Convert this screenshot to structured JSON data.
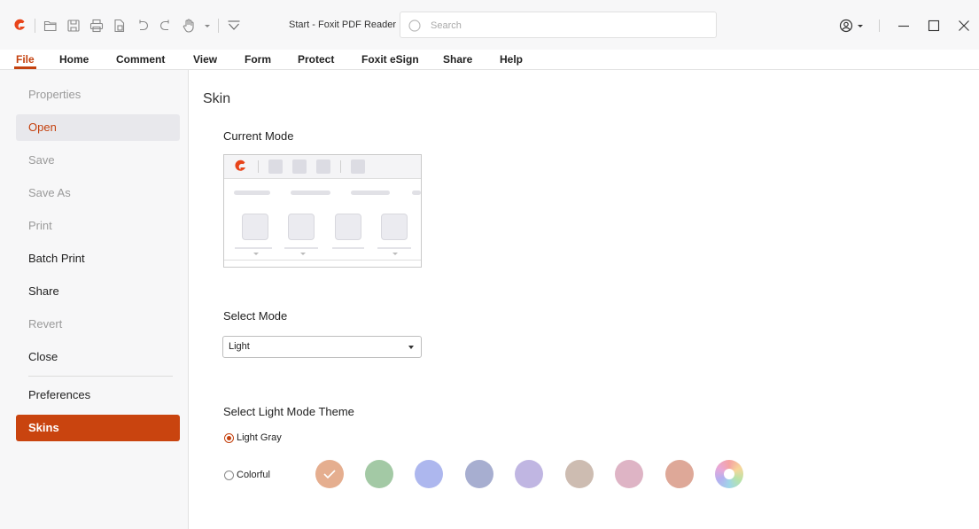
{
  "titlebar": {
    "doc_title": "Start - Foxit PDF Reader",
    "search_placeholder": "Search",
    "accent_color": "#e8441a",
    "icons": [
      "foxit-logo-icon",
      "open-icon",
      "save-icon",
      "print-icon",
      "new-file-icon",
      "undo-icon",
      "redo-icon",
      "hand-tool-icon",
      "customize-dropdown-icon",
      "quick-access-icon"
    ]
  },
  "menu": [
    "File",
    "Home",
    "Comment",
    "View",
    "Form",
    "Protect",
    "Foxit eSign",
    "Share",
    "Help"
  ],
  "sidebar": {
    "items": [
      {
        "label": "Properties",
        "state": "disabled"
      },
      {
        "label": "Open",
        "state": "hover"
      },
      {
        "label": "Save",
        "state": "disabled"
      },
      {
        "label": "Save As",
        "state": "disabled"
      },
      {
        "label": "Print",
        "state": "disabled"
      },
      {
        "label": "Batch Print",
        "state": "normal"
      },
      {
        "label": "Share",
        "state": "normal"
      },
      {
        "label": "Revert",
        "state": "disabled"
      },
      {
        "label": "Close",
        "state": "normal"
      },
      {
        "label": "Preferences",
        "state": "normal"
      },
      {
        "label": "Skins",
        "state": "selected"
      }
    ],
    "selected_color": "#c9440f"
  },
  "content": {
    "heading": "Skin",
    "current_mode_label": "Current Mode",
    "select_mode_label": "Select Mode",
    "select_mode_value": "Light",
    "theme_label": "Select Light Mode Theme",
    "options": {
      "light_gray": {
        "label": "Light Gray",
        "checked": true
      },
      "colorful": {
        "label": "Colorful",
        "checked": false
      }
    },
    "swatches": [
      {
        "name": "orange",
        "color": "#e5ae8f",
        "checked": true
      },
      {
        "name": "green",
        "color": "#a3c9a5",
        "checked": false
      },
      {
        "name": "periwinkle",
        "color": "#adb7ee",
        "checked": false
      },
      {
        "name": "slate-blue",
        "color": "#a7aed0",
        "checked": false
      },
      {
        "name": "lavender",
        "color": "#c0b6e2",
        "checked": false
      },
      {
        "name": "taupe",
        "color": "#cdbcb1",
        "checked": false
      },
      {
        "name": "pink",
        "color": "#deb4c5",
        "checked": false
      },
      {
        "name": "terracotta",
        "color": "#dea898",
        "checked": false
      },
      {
        "name": "rainbow",
        "color": "conic",
        "checked": false
      }
    ]
  }
}
